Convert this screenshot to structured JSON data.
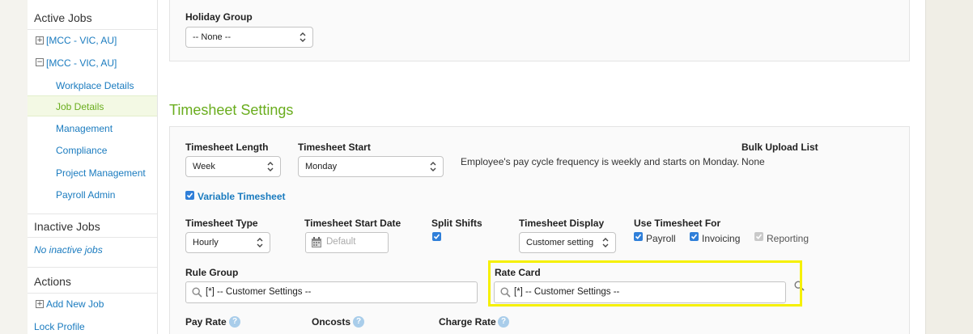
{
  "sidebar": {
    "active_jobs_title": "Active Jobs",
    "jobs": [
      {
        "label": "[MCC - VIC, AU]",
        "expander": "+"
      },
      {
        "label": "[MCC - VIC, AU]",
        "expander": "−"
      }
    ],
    "job_items": [
      "Workplace Details",
      "Job Details",
      "Management",
      "Compliance",
      "Project Management",
      "Payroll Admin"
    ],
    "active_item": "Job Details",
    "inactive_jobs_title": "Inactive Jobs",
    "inactive_empty": "No inactive jobs",
    "actions_title": "Actions",
    "actions": [
      {
        "label": "Add New Job",
        "expander": "+"
      },
      {
        "label": "Lock Profile"
      }
    ]
  },
  "holiday": {
    "label": "Holiday Group",
    "value": "-- None --"
  },
  "timesheet": {
    "heading": "Timesheet Settings",
    "length_label": "Timesheet Length",
    "length_value": "Week",
    "start_label": "Timesheet Start",
    "start_value": "Monday",
    "cycle_note": "Employee's pay cycle frequency is weekly and starts on Monday.",
    "bulk_label": "Bulk Upload List",
    "bulk_value": "None",
    "variable_label": "Variable Timesheet",
    "type_label": "Timesheet Type",
    "type_value": "Hourly",
    "start_date_label": "Timesheet Start Date",
    "start_date_placeholder": "Default",
    "split_label": "Split Shifts",
    "display_label": "Timesheet Display",
    "display_value": "Customer setting",
    "use_for_label": "Use Timesheet For",
    "use_for": [
      {
        "label": "Payroll",
        "checked": true,
        "disabled": false
      },
      {
        "label": "Invoicing",
        "checked": true,
        "disabled": false
      },
      {
        "label": "Reporting",
        "checked": true,
        "disabled": true
      }
    ],
    "rule_group_label": "Rule Group",
    "rule_group_value": "[*] -- Customer Settings --",
    "rate_card_label": "Rate Card",
    "rate_card_value": "[*] -- Customer Settings --",
    "pay_rate_label": "Pay Rate",
    "oncosts_label": "Oncosts",
    "charge_rate_label": "Charge Rate"
  },
  "colors": {
    "link": "#1a7bbf",
    "heading_green": "#6aad1e",
    "highlight": "#f5f000",
    "checkbox": "#2f7fd9"
  }
}
